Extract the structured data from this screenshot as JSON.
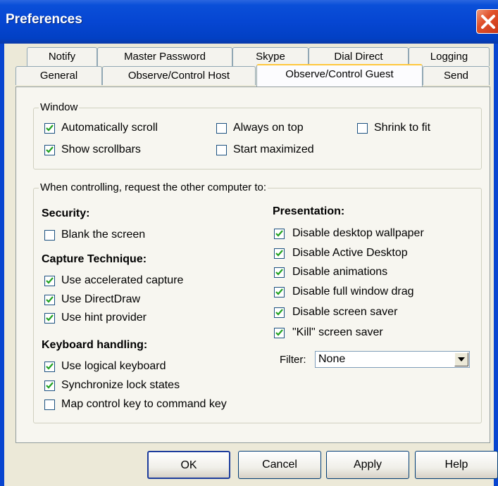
{
  "window": {
    "title": "Preferences"
  },
  "tabs_back": [
    "Notify",
    "Master Password",
    "Skype",
    "Dial Direct",
    "Logging"
  ],
  "tabs_front": [
    "General",
    "Observe/Control Host",
    "Observe/Control Guest",
    "Send"
  ],
  "active_tab": "Observe/Control Guest",
  "window_group": {
    "legend": "Window",
    "options": [
      {
        "label": "Automatically scroll",
        "checked": true
      },
      {
        "label": "Show scrollbars",
        "checked": true
      },
      {
        "label": "Always on top",
        "checked": false
      },
      {
        "label": "Start maximized",
        "checked": false
      },
      {
        "label": "Shrink to fit",
        "checked": false
      }
    ]
  },
  "control_group": {
    "legend": "When controlling, request the other computer to:",
    "security": {
      "heading": "Security:",
      "options": [
        {
          "label": "Blank the screen",
          "checked": false
        }
      ]
    },
    "capture": {
      "heading": "Capture Technique:",
      "options": [
        {
          "label": "Use accelerated capture",
          "checked": true
        },
        {
          "label": "Use DirectDraw",
          "checked": true
        },
        {
          "label": "Use hint provider",
          "checked": true
        }
      ]
    },
    "keyboard": {
      "heading": "Keyboard handling:",
      "options": [
        {
          "label": "Use logical keyboard",
          "checked": true
        },
        {
          "label": "Synchronize lock states",
          "checked": true
        },
        {
          "label": "Map control key to command key",
          "checked": false
        }
      ]
    },
    "presentation": {
      "heading": "Presentation:",
      "options": [
        {
          "label": "Disable desktop wallpaper",
          "checked": true
        },
        {
          "label": "Disable Active Desktop",
          "checked": true
        },
        {
          "label": "Disable animations",
          "checked": true
        },
        {
          "label": "Disable full window drag",
          "checked": true
        },
        {
          "label": "Disable screen saver",
          "checked": true
        },
        {
          "label": "\"Kill\" screen saver",
          "checked": true
        }
      ]
    },
    "filter": {
      "label": "Filter:",
      "value": "None"
    }
  },
  "buttons": {
    "ok": "OK",
    "cancel": "Cancel",
    "apply": "Apply",
    "help": "Help"
  }
}
